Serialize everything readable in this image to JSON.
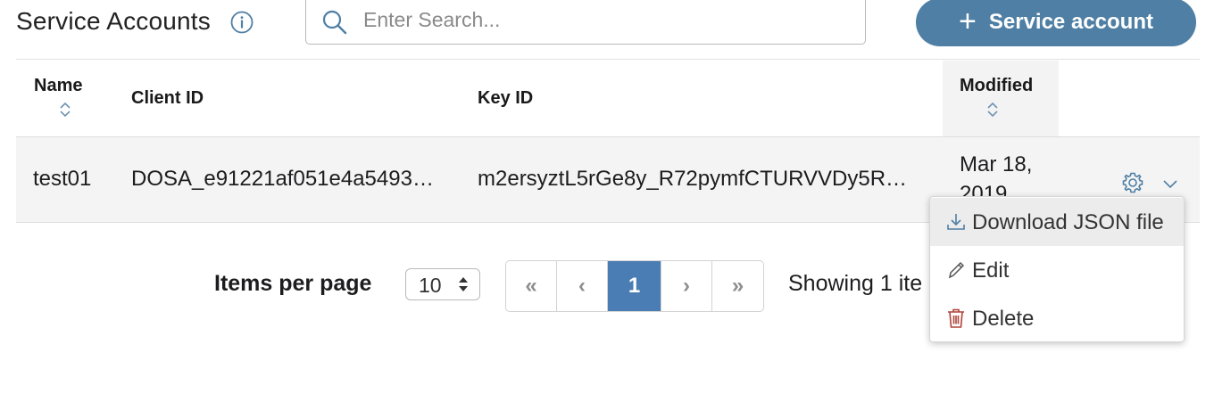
{
  "header": {
    "title": "Service Accounts",
    "info_icon": "info-circle-icon",
    "search_placeholder": "Enter Search...",
    "search_value": "",
    "add_button_label": "Service account",
    "add_button_icon": "plus-icon",
    "accent_color": "#4f7fa4"
  },
  "table": {
    "columns": [
      {
        "label": "Name",
        "sortable": true
      },
      {
        "label": "Client ID",
        "sortable": false
      },
      {
        "label": "Key ID",
        "sortable": false
      },
      {
        "label": "Modified",
        "sortable": true
      }
    ],
    "rows": [
      {
        "name": "test01",
        "client_id": "DOSA_e91221af051e4a5493…",
        "key_id": "m2ersyztL5rGe8y_R72pymfCTURVVDy5R…",
        "modified_line1": "Mar 18,",
        "modified_line2": "2019",
        "actions": [
          "gear-icon",
          "chevron-down-icon"
        ]
      }
    ]
  },
  "row_menu": {
    "items": [
      {
        "label": "Download JSON file",
        "icon": "download-icon",
        "hovered": true
      },
      {
        "label": "Edit",
        "icon": "pencil-icon",
        "hovered": false
      },
      {
        "label": "Delete",
        "icon": "trash-icon",
        "hovered": false,
        "color": "#b0443a"
      }
    ]
  },
  "pagination": {
    "items_per_page_label": "Items per page",
    "items_per_page_value": "10",
    "buttons": [
      "«",
      "‹",
      "1",
      "›",
      "»"
    ],
    "current_page": "1",
    "showing_text": "Showing 1 ite",
    "active_color": "#4a7db3"
  }
}
